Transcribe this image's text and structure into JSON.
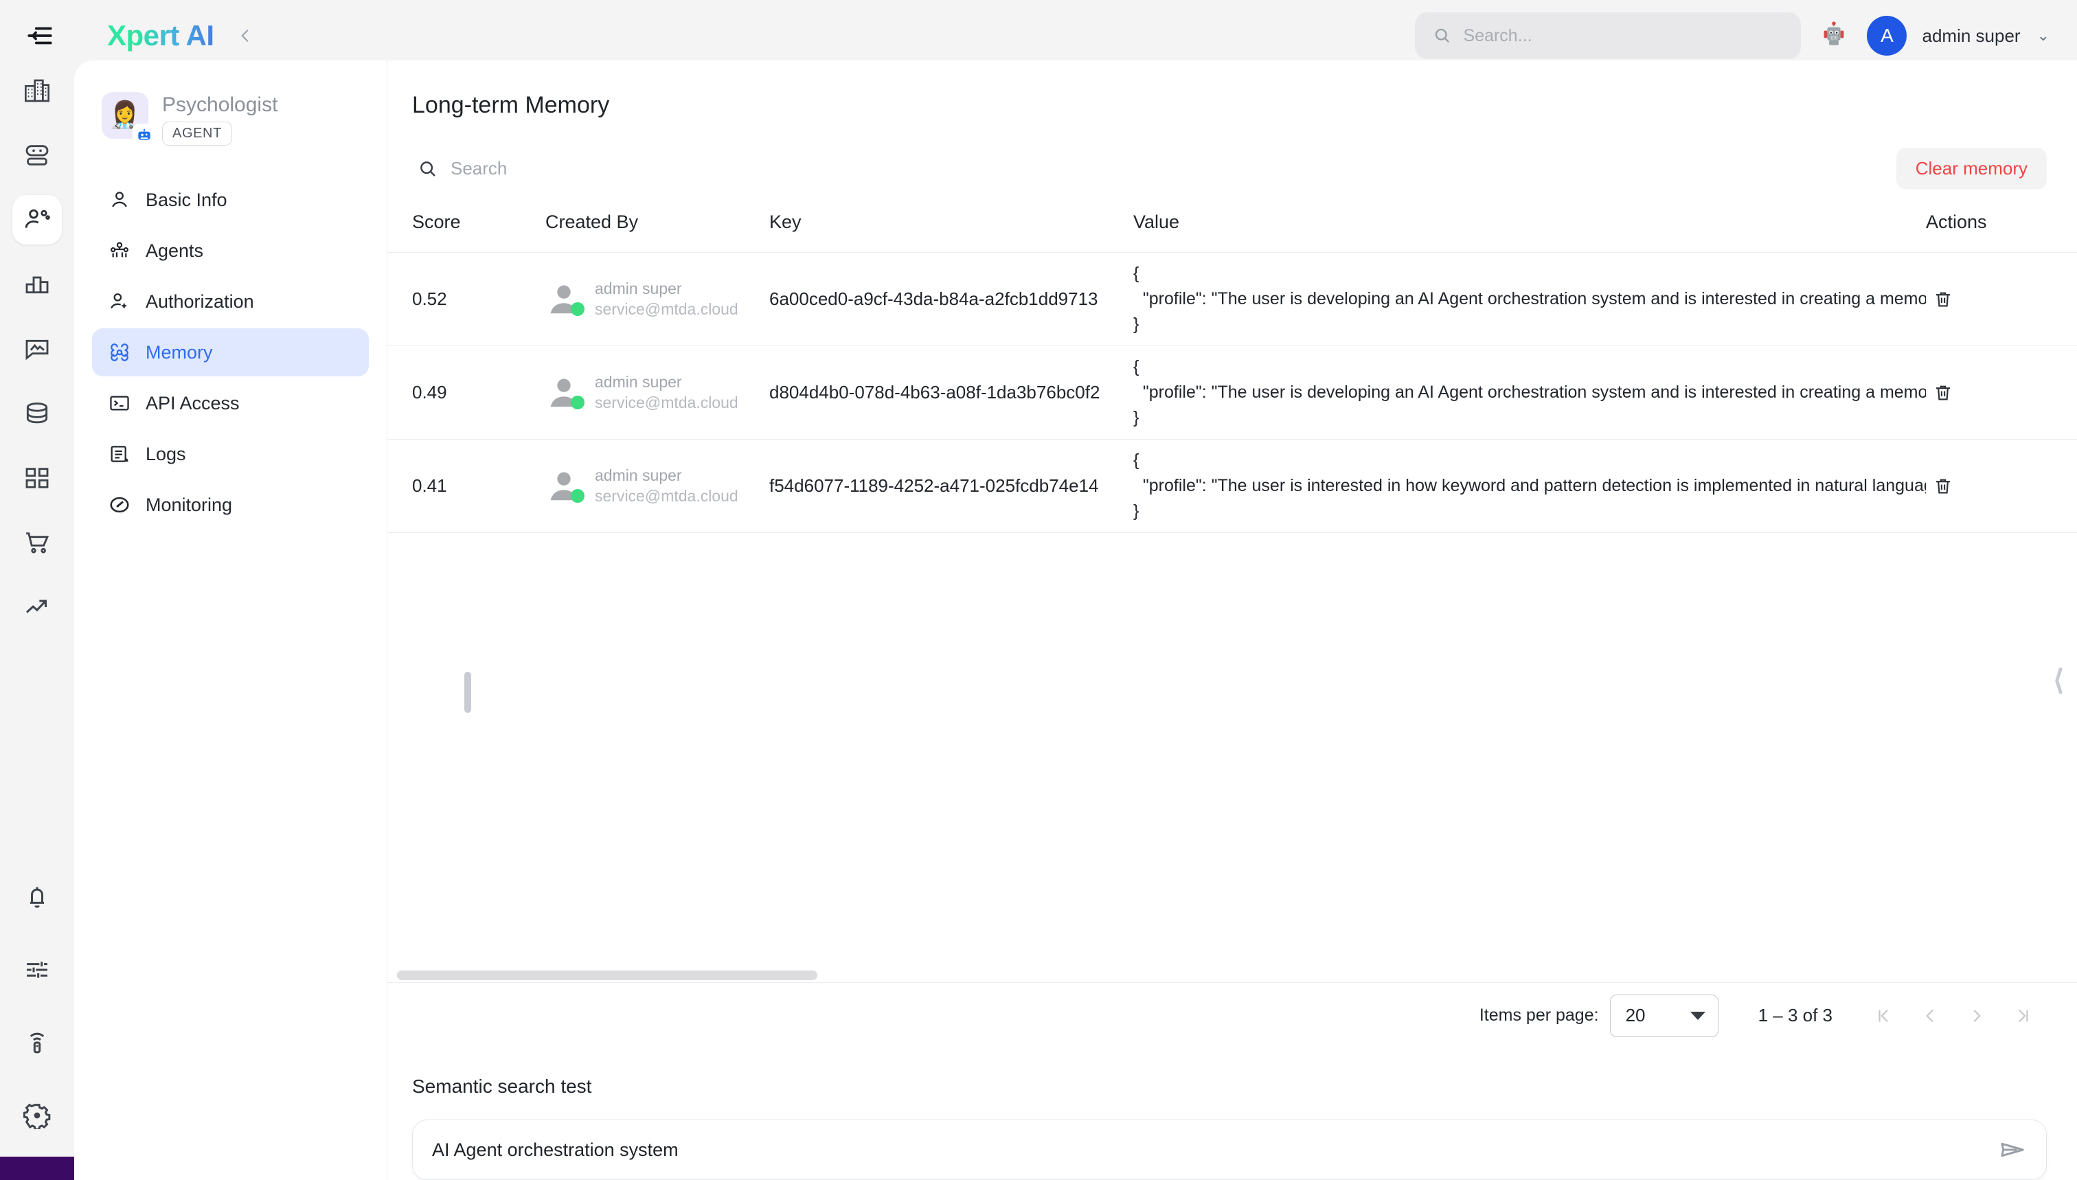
{
  "topbar": {
    "hamburger_icon": "menu-collapse-icon",
    "brand_part1": "Xpert",
    "brand_part2": "AI",
    "collapse_icon": "chevron-left-icon",
    "search_placeholder": "Search...",
    "search_value": "",
    "search_icon": "search-icon",
    "robot_icon": "robot-icon",
    "avatar_initial": "A",
    "user_name": "admin super",
    "user_caret": "⌄",
    "avatar_color": "#1f56e3"
  },
  "rail": {
    "top_items": [
      {
        "name": "organization-icon",
        "active": false
      },
      {
        "name": "robot-icon",
        "active": false
      },
      {
        "name": "user-settings-icon",
        "active": true
      },
      {
        "name": "bar-chart-icon",
        "active": false
      },
      {
        "name": "image-message-icon",
        "active": false
      },
      {
        "name": "database-icon",
        "active": false
      },
      {
        "name": "dashboard-grid-icon",
        "active": false
      },
      {
        "name": "shopping-cart-icon",
        "active": false
      },
      {
        "name": "trending-up-icon",
        "active": false
      }
    ],
    "bottom_items": [
      {
        "name": "bell-icon"
      },
      {
        "name": "sliders-icon"
      },
      {
        "name": "remote-signal-icon"
      },
      {
        "name": "gear-icon"
      }
    ]
  },
  "sidebar": {
    "agent": {
      "avatar_emoji": "👩‍⚕️",
      "name": "Psychologist",
      "tag": "AGENT",
      "badge_icon": "robot-badge-icon"
    },
    "items": [
      {
        "label": "Basic Info",
        "icon": "user-icon",
        "active": false
      },
      {
        "label": "Agents",
        "icon": "users-group-icon",
        "active": false
      },
      {
        "label": "Authorization",
        "icon": "user-plus-icon",
        "active": false
      },
      {
        "label": "Memory",
        "icon": "brain-icon",
        "active": true
      },
      {
        "label": "API Access",
        "icon": "terminal-icon",
        "active": false
      },
      {
        "label": "Logs",
        "icon": "document-list-icon",
        "active": false
      },
      {
        "label": "Monitoring",
        "icon": "gauge-icon",
        "active": false
      }
    ]
  },
  "main": {
    "title": "Long-term Memory",
    "search_placeholder": "Search",
    "search_value": "",
    "search_icon": "search-icon",
    "clear_button": "Clear memory",
    "clear_button_color": "#ef4444",
    "table": {
      "columns": [
        "Score",
        "Created By",
        "Key",
        "Value",
        "Actions"
      ],
      "rows": [
        {
          "score": "0.52",
          "created_by_name": "admin super",
          "created_by_email": "service@mtda.cloud",
          "status": "online",
          "key": "6a00ced0-a9cf-43da-b84a-a2fcb1dd9713",
          "value": "{\n  \"profile\": \"The user is developing an AI Agent orchestration system and is interested in creating a memory\n}",
          "action_icon": "trash-icon"
        },
        {
          "score": "0.49",
          "created_by_name": "admin super",
          "created_by_email": "service@mtda.cloud",
          "status": "online",
          "key": "d804d4b0-078d-4b63-a08f-1da3b76bc0f2",
          "value": "{\n  \"profile\": \"The user is developing an AI Agent orchestration system and is interested in creating a memory\n}",
          "action_icon": "trash-icon"
        },
        {
          "score": "0.41",
          "created_by_name": "admin super",
          "created_by_email": "service@mtda.cloud",
          "status": "online",
          "key": "f54d6077-1189-4252-a471-025fcdb74e14",
          "value": "{\n  \"profile\": \"The user is interested in how keyword and pattern detection is implemented in natural languag\n}",
          "action_icon": "trash-icon"
        }
      ]
    },
    "paginator": {
      "items_per_page_label": "Items per page:",
      "items_per_page_value": "20",
      "range_label": "1 – 3 of 3",
      "first_page_icon": "first-page-icon",
      "prev_page_icon": "prev-page-icon",
      "next_page_icon": "next-page-icon",
      "last_page_icon": "last-page-icon"
    },
    "semantic": {
      "title": "Semantic search test",
      "input_value": "AI Agent orchestration system",
      "input_placeholder": "",
      "send_icon": "send-icon"
    }
  }
}
